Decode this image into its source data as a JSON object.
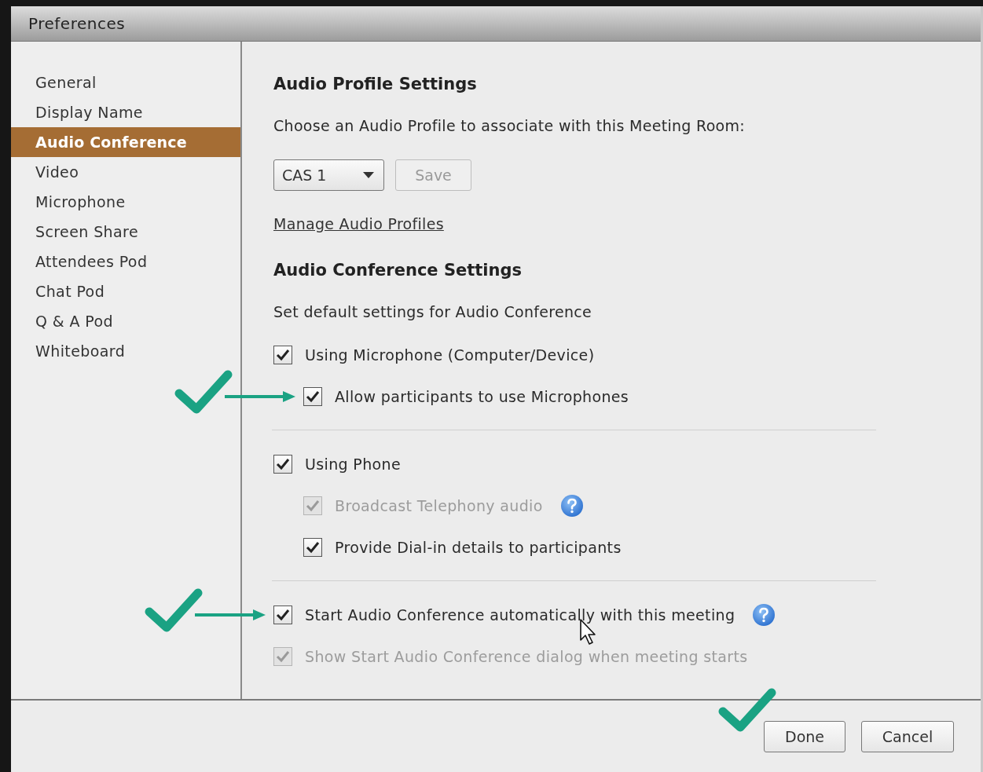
{
  "window": {
    "title": "Preferences"
  },
  "sidebar": {
    "items": [
      {
        "label": "General",
        "selected": false
      },
      {
        "label": "Display Name",
        "selected": false
      },
      {
        "label": "Audio Conference",
        "selected": true
      },
      {
        "label": "Video",
        "selected": false
      },
      {
        "label": "Microphone",
        "selected": false
      },
      {
        "label": "Screen Share",
        "selected": false
      },
      {
        "label": "Attendees Pod",
        "selected": false
      },
      {
        "label": "Chat Pod",
        "selected": false
      },
      {
        "label": "Q & A Pod",
        "selected": false
      },
      {
        "label": "Whiteboard",
        "selected": false
      }
    ]
  },
  "audio_profile": {
    "heading": "Audio Profile Settings",
    "description": "Choose an Audio Profile to associate with this Meeting Room:",
    "profile_dropdown": {
      "value": "CAS 1"
    },
    "save_button": {
      "label": "Save",
      "disabled": true
    },
    "link": "Manage Audio Profiles"
  },
  "audio_conference": {
    "heading": "Audio Conference Settings",
    "description": "Set default settings for Audio Conference",
    "groups": [
      [
        {
          "label": "Using Microphone (Computer/Device)",
          "checked": true,
          "disabled": false,
          "children": [
            {
              "label": "Allow participants to use Microphones",
              "checked": true,
              "disabled": false,
              "annotated": true
            }
          ]
        }
      ],
      [
        {
          "label": "Using Phone",
          "checked": true,
          "disabled": false,
          "children": [
            {
              "label": "Broadcast Telephony audio",
              "checked": true,
              "disabled": true,
              "help": true
            },
            {
              "label": "Provide Dial-in details to participants",
              "checked": true,
              "disabled": false
            }
          ]
        }
      ],
      [
        {
          "label": "Start Audio Conference automatically with this meeting",
          "checked": true,
          "disabled": false,
          "help": true,
          "annotated": true
        },
        {
          "label": "Show Start Audio Conference dialog when meeting starts",
          "checked": true,
          "disabled": true
        }
      ]
    ]
  },
  "buttons": [
    {
      "label": "Done",
      "annotated": true
    },
    {
      "label": "Cancel"
    }
  ],
  "cursor": {
    "kind": "arrow"
  }
}
